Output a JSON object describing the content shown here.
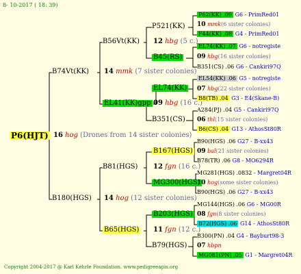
{
  "header": "8- 10-2017 ( 18: 39)",
  "footer": "Copyright 2004-2017 @ Karl Kehrle Foundation.   www.pedigreeapis.org",
  "root": {
    "label": "P6(HJT)",
    "num": "16",
    "word": "hog",
    "note": "(Drones from 14 sister colonies)"
  },
  "sires": [
    {
      "label": "B74Vt(KK)",
      "num": "14",
      "word": "mmk",
      "note": "(7 sister colonies)"
    },
    {
      "label": "B180(HGS)",
      "num": "14",
      "word": "hog",
      "note": "(12 sister colonies)"
    }
  ],
  "grand": [
    {
      "label": "B56Vt(KK)",
      "num": "12",
      "word": "hbg",
      "note": "(5 c.)"
    },
    {
      "label": "EL41(KK)gpp",
      "num": "09",
      "word": "hbg",
      "note": "(16 c.)"
    },
    {
      "label": "B81(HGS)",
      "num": "12",
      "word": "fgn",
      "note": "(16 c.)"
    },
    {
      "label": "B65(HGS)",
      "num": "11",
      "word": "fgn",
      "note": "(12 c.)"
    }
  ],
  "great": [
    {
      "label": "P521(KK)"
    },
    {
      "label": "B45(RS)"
    },
    {
      "label": "EL74(KK)"
    },
    {
      "label": "B351(CS)"
    },
    {
      "label": "B167(HGS)"
    },
    {
      "label": "MG300(HGS)"
    },
    {
      "label": "B203(HGS)"
    },
    {
      "label": "B79(HGS)"
    }
  ],
  "leaves": [
    {
      "a": "P62(KK) .09",
      "b": "G6 - PrimRed01"
    },
    {
      "num": "10",
      "word": "mmk",
      "note": "(6 sister colonies)"
    },
    {
      "a": "F44(KK) .08",
      "b": "G4 - PrimRed01"
    },
    {
      "a": "EL74(KK) .07",
      "b": "G6 - notregiste"
    },
    {
      "num": "09",
      "word": "hbg",
      "note": "(16 sister colonies)"
    },
    {
      "a": "B351(CS) .06",
      "b": "G6 - Cankiri97Q"
    },
    {
      "a": "EL54(KK) .06",
      "b": "G5 - notregiste"
    },
    {
      "num": "07",
      "word": "hbg",
      "note": "(22 sister colonies)"
    },
    {
      "a": "B8(TB) .04",
      "b": "G3 - E4(Skane-B)"
    },
    {
      "a": "A284(PJ) .04",
      "b": "G5 - Cankiri97Q"
    },
    {
      "num": "06",
      "word": "thl",
      "note": "(15 sister colonies)"
    },
    {
      "a": "B6(CS) .04",
      "b": "G13 - AthosSt80R"
    },
    {
      "a": "B90(HGS) .06",
      "b": "G27 - B-xx43"
    },
    {
      "num": "09",
      "word": "bal",
      "note": "(21 sister colonies)"
    },
    {
      "a": "B78(TR) .06",
      "b": "G8 - MO6294R"
    },
    {
      "a": "MG281(HGS) .0832",
      "b": "- Margret04R"
    },
    {
      "num": "10",
      "word": "hog",
      "note": "(some sister colonies)"
    },
    {
      "a": "B90(HGS) .06",
      "b": "G27 - B-xx43"
    },
    {
      "a": "MG144(HGS) .06",
      "b": "G6 - MG00R"
    },
    {
      "num": "08",
      "word": "fgn",
      "note": "(8 sister colonies)"
    },
    {
      "a": "B72(HGS) .06",
      "b": "G14 - AthosSt80R"
    },
    {
      "a": "B300(PN) .04",
      "b": "G4 - Bayburt98-3"
    },
    {
      "num": "07",
      "word": "hbpn",
      "note": ""
    },
    {
      "a": "MG081(PN) .05",
      "b": "G1 - Margret04R"
    }
  ]
}
